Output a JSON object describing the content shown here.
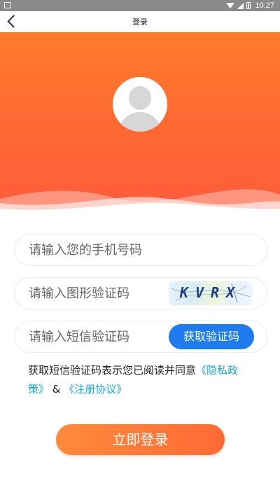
{
  "status_bar": {
    "time": "10:27"
  },
  "header": {
    "title": "登录",
    "back_icon": "chevron-left-icon"
  },
  "form": {
    "phone": {
      "placeholder": "请输入您的手机号码",
      "value": ""
    },
    "captcha": {
      "placeholder": "请输入图形验证码",
      "value": "",
      "image_text": "KVRX"
    },
    "sms": {
      "placeholder": "请输入短信验证码",
      "value": "",
      "button_label": "获取验证码"
    }
  },
  "agreement": {
    "text": "获取短信验证码表示您已阅读并同意",
    "privacy_link": "《隐私政策》",
    "and": " & ",
    "terms_link": "《注册协议》"
  },
  "login_button": "立即登录",
  "colors": {
    "accent_orange": "#ff6a32",
    "button_blue": "#1e7bf0",
    "link_blue": "#18a7d9"
  }
}
